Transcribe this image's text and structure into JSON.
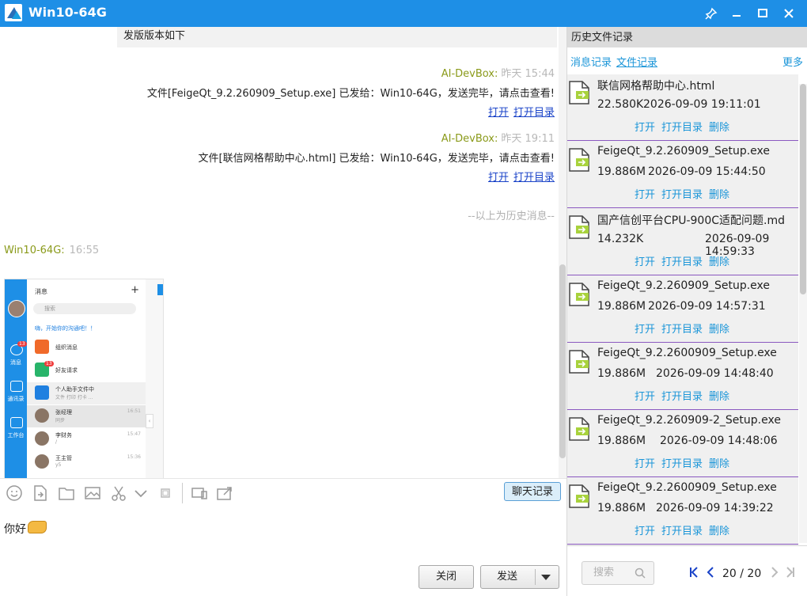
{
  "window": {
    "title": "Win10-64G"
  },
  "chat": {
    "notice": "发版版本如下",
    "messages": [
      {
        "sender": "AI-DevBox:",
        "time": "昨天 15:44",
        "text": "文件[FeigeQt_9.2.260909_Setup.exe] 已发给：Win10-64G，发送完毕，请点击查看!",
        "open": "打开",
        "open_dir": "打开目录"
      },
      {
        "sender": "AI-DevBox:",
        "time": "昨天 19:11",
        "text": "文件[联信网格帮助中心.html] 已发给：Win10-64G，发送完毕，请点击查看!",
        "open": "打开",
        "open_dir": "打开目录"
      }
    ],
    "history_divider": "--以上为历史消息--",
    "me": {
      "sender": "Win10-64G:",
      "time": "16:55"
    },
    "screenshot": {
      "title": "消息",
      "search": "搜索",
      "notice": "嗨，开始你的沟通吧！！",
      "side_labels": [
        "消息",
        "通讯录",
        "工作台"
      ],
      "badge": "13",
      "items": [
        {
          "name": "组织消息",
          "sub": "",
          "time": ""
        },
        {
          "name": "好友请求",
          "sub": "",
          "time": ""
        },
        {
          "name": "个人助手文件中",
          "sub": "文件 打印 打卡 ...",
          "time": ""
        },
        {
          "name": "张经理",
          "sub": "同步",
          "time": "16:51"
        },
        {
          "name": "李财务",
          "sub": "/",
          "time": "15:47"
        },
        {
          "name": "王主管",
          "sub": "y5",
          "time": "15:36"
        }
      ]
    }
  },
  "toolbar": {
    "icons": [
      "emoji-icon",
      "send-file-icon",
      "folder-icon",
      "image-icon",
      "screenshot-icon",
      "chevron-down-icon",
      "history-icon",
      "remote-desktop-icon",
      "screen-share-icon"
    ],
    "chat_history": "聊天记录"
  },
  "input": {
    "text": "你好"
  },
  "buttons": {
    "close": "关闭",
    "send": "发送"
  },
  "history_panel": {
    "title": "历史文件记录",
    "tabs": [
      "消息记录",
      "文件记录"
    ],
    "more": "更多",
    "actions": [
      "打开",
      "打开目录",
      "删除"
    ],
    "files": [
      {
        "name": "联信网格帮助中心.html",
        "size": "22.580K",
        "date": "2026-09-09 19:11:01"
      },
      {
        "name": "FeigeQt_9.2.260909_Setup.exe",
        "size": "19.886M",
        "date": "2026-09-09 15:44:50"
      },
      {
        "name": "国产信创平台CPU-900C适配问题.md",
        "size": "14.232K",
        "date": "2026-09-09 14:59:33"
      },
      {
        "name": "FeigeQt_9.2.260909_Setup.exe",
        "size": "19.886M",
        "date": "2026-09-09 14:57:31"
      },
      {
        "name": "FeigeQt_9.2.2600909_Setup.exe",
        "size": "19.886M",
        "date": "2026-09-09 14:48:40"
      },
      {
        "name": "FeigeQt_9.2.260909-2_Setup.exe",
        "size": "19.886M",
        "date": "2026-09-09 14:48:06"
      },
      {
        "name": "FeigeQt_9.2.2600909_Setup.exe",
        "size": "19.886M",
        "date": "2026-09-09 14:39:22"
      }
    ],
    "search_placeholder": "搜索",
    "page": "20 / 20"
  },
  "colors": {
    "titlebar": "#1e8fe6",
    "link": "#1a95d8",
    "sender": "#8a9a1a",
    "card_border": "#8a58c0"
  }
}
